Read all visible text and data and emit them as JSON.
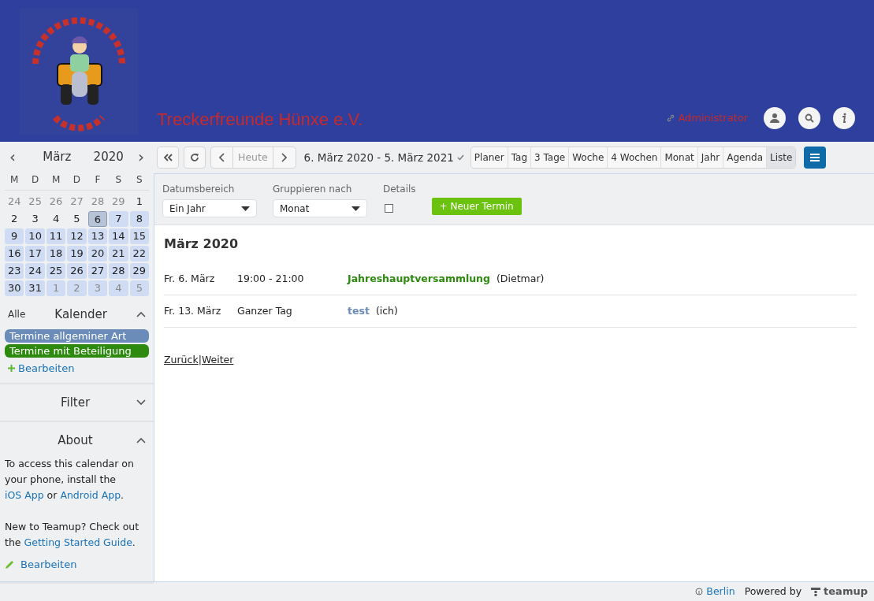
{
  "header": {
    "title": "Treckerfreunde Hünxe e.V.",
    "user_link": "Administrator"
  },
  "mini_calendar": {
    "month": "März",
    "year": "2020",
    "prev": "‹",
    "next": "›",
    "weekdays": [
      "M",
      "D",
      "M",
      "D",
      "F",
      "S",
      "S"
    ],
    "days": [
      {
        "day": "24",
        "muted": true,
        "events": false,
        "selected": false
      },
      {
        "day": "25",
        "muted": true,
        "events": false,
        "selected": false
      },
      {
        "day": "26",
        "muted": true,
        "events": false,
        "selected": false
      },
      {
        "day": "27",
        "muted": true,
        "events": false,
        "selected": false
      },
      {
        "day": "28",
        "muted": true,
        "events": false,
        "selected": false
      },
      {
        "day": "29",
        "muted": true,
        "events": false,
        "selected": false
      },
      {
        "day": "1",
        "muted": false,
        "events": false,
        "selected": false
      },
      {
        "day": "2",
        "muted": false,
        "events": false,
        "selected": false
      },
      {
        "day": "3",
        "muted": false,
        "events": false,
        "selected": false
      },
      {
        "day": "4",
        "muted": false,
        "events": false,
        "selected": false
      },
      {
        "day": "5",
        "muted": false,
        "events": false,
        "selected": false
      },
      {
        "day": "6",
        "muted": false,
        "events": true,
        "selected": true
      },
      {
        "day": "7",
        "muted": false,
        "events": true,
        "selected": false
      },
      {
        "day": "8",
        "muted": false,
        "events": true,
        "selected": false
      },
      {
        "day": "9",
        "muted": false,
        "events": true,
        "selected": false
      },
      {
        "day": "10",
        "muted": false,
        "events": true,
        "selected": false
      },
      {
        "day": "11",
        "muted": false,
        "events": true,
        "selected": false
      },
      {
        "day": "12",
        "muted": false,
        "events": true,
        "selected": false
      },
      {
        "day": "13",
        "muted": false,
        "events": true,
        "selected": false
      },
      {
        "day": "14",
        "muted": false,
        "events": true,
        "selected": false
      },
      {
        "day": "15",
        "muted": false,
        "events": true,
        "selected": false
      },
      {
        "day": "16",
        "muted": false,
        "events": true,
        "selected": false
      },
      {
        "day": "17",
        "muted": false,
        "events": true,
        "selected": false
      },
      {
        "day": "18",
        "muted": false,
        "events": true,
        "selected": false
      },
      {
        "day": "19",
        "muted": false,
        "events": true,
        "selected": false
      },
      {
        "day": "20",
        "muted": false,
        "events": true,
        "selected": false
      },
      {
        "day": "21",
        "muted": false,
        "events": true,
        "selected": false
      },
      {
        "day": "22",
        "muted": false,
        "events": true,
        "selected": false
      },
      {
        "day": "23",
        "muted": false,
        "events": true,
        "selected": false
      },
      {
        "day": "24",
        "muted": false,
        "events": true,
        "selected": false
      },
      {
        "day": "25",
        "muted": false,
        "events": true,
        "selected": false
      },
      {
        "day": "26",
        "muted": false,
        "events": true,
        "selected": false
      },
      {
        "day": "27",
        "muted": false,
        "events": true,
        "selected": false
      },
      {
        "day": "28",
        "muted": false,
        "events": true,
        "selected": false
      },
      {
        "day": "29",
        "muted": false,
        "events": true,
        "selected": false
      },
      {
        "day": "30",
        "muted": false,
        "events": true,
        "selected": false
      },
      {
        "day": "31",
        "muted": false,
        "events": true,
        "selected": false
      },
      {
        "day": "1",
        "muted": true,
        "events": true,
        "selected": false
      },
      {
        "day": "2",
        "muted": true,
        "events": true,
        "selected": false
      },
      {
        "day": "3",
        "muted": true,
        "events": true,
        "selected": false
      },
      {
        "day": "4",
        "muted": true,
        "events": true,
        "selected": false
      },
      {
        "day": "5",
        "muted": true,
        "events": true,
        "selected": false
      }
    ]
  },
  "calendars": {
    "all_label": "Alle",
    "title": "Kalender",
    "expanded": true,
    "items": [
      {
        "name": "Termine allgeminer Art",
        "color": "#6b8cb8"
      },
      {
        "name": "Termine mit Beteiligung",
        "color": "#2d8a0f"
      }
    ],
    "edit": "Bearbeiten"
  },
  "filter": {
    "title": "Filter",
    "expanded": false
  },
  "about": {
    "title": "About",
    "expanded": true,
    "paragraphs": [
      [
        {
          "kind": "text",
          "text": "To access this calendar on your phone, install the "
        },
        {
          "kind": "link",
          "text": "iOS App"
        },
        {
          "kind": "text",
          "text": " or "
        },
        {
          "kind": "link",
          "text": "Android App"
        },
        {
          "kind": "text",
          "text": "."
        }
      ],
      [
        {
          "kind": "text",
          "text": "New to Teamup? Check out the "
        },
        {
          "kind": "link",
          "text": "Getting Started Guide"
        },
        {
          "kind": "text",
          "text": "."
        }
      ]
    ],
    "edit": "Bearbeiten"
  },
  "toolbar": {
    "today": "Heute",
    "range": "6. März 2020 - 5. März 2021",
    "views": [
      {
        "label": "Planer",
        "selected": false
      },
      {
        "label": "Tag",
        "selected": false
      },
      {
        "label": "3 Tage",
        "selected": false
      },
      {
        "label": "Woche",
        "selected": false
      },
      {
        "label": "4 Wochen",
        "selected": false
      },
      {
        "label": "Monat",
        "selected": false
      },
      {
        "label": "Jahr",
        "selected": false
      },
      {
        "label": "Agenda",
        "selected": false
      },
      {
        "label": "Liste",
        "selected": true
      }
    ]
  },
  "options": {
    "date_range": {
      "label": "Datumsbereich",
      "value": "Ein Jahr"
    },
    "group_by": {
      "label": "Gruppieren nach",
      "value": "Monat"
    },
    "details": {
      "label": "Details",
      "checked": false
    },
    "new_event": "+ Neuer Termin"
  },
  "list": {
    "group": "März 2020",
    "events": [
      {
        "date": "Fr. 6. März",
        "time": "19:00 - 21:00",
        "title": "Jahreshauptversammlung",
        "color": "#2d8a0f",
        "who": "(Dietmar)"
      },
      {
        "date": "Fr. 13. März",
        "time": "Ganzer Tag",
        "title": "test",
        "color": "#6b8cb8",
        "who": "(ich)"
      }
    ],
    "back": "Zurück",
    "separator": "|",
    "next": "Weiter"
  },
  "footer": {
    "location": "Berlin",
    "powered": "Powered by",
    "brand": "teamup"
  }
}
